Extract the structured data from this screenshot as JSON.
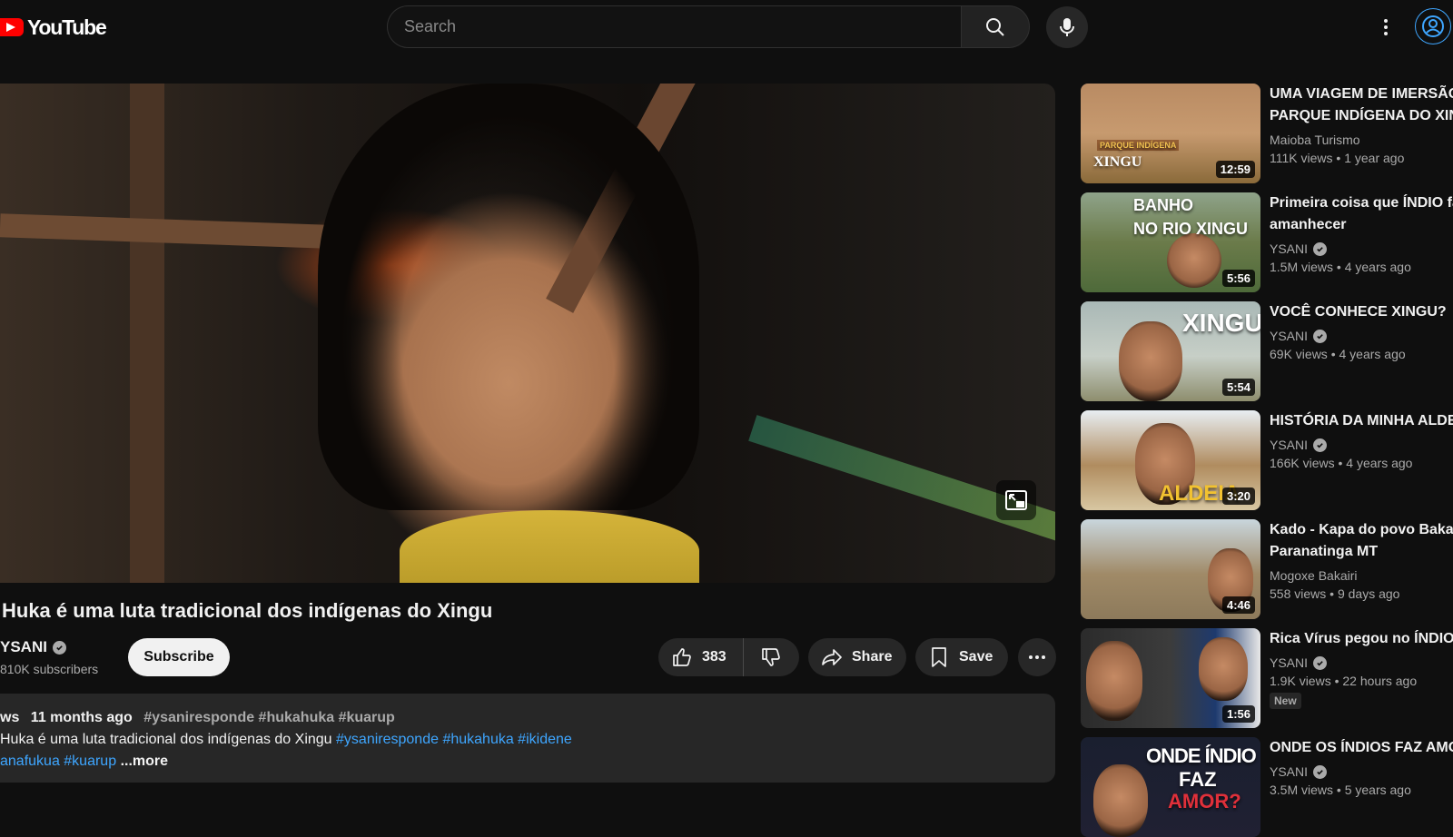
{
  "header": {
    "logo_text": "YouTube",
    "search_placeholder": "Search"
  },
  "player": {
    "title": "Huka é uma luta tradicional dos indígenas do Xingu"
  },
  "owner": {
    "channel": "YSANI",
    "subscribers": "810K subscribers",
    "subscribe_label": "Subscribe"
  },
  "actions": {
    "likes": "383",
    "share_label": "Share",
    "save_label": "Save"
  },
  "description": {
    "views_fragment": "ws",
    "date": "11 months ago",
    "tags": "#ysaniresponde #hukahuka #kuarup",
    "line1_text": "Huka é uma luta tradicional dos indígenas do Xingu",
    "line1_tags": "#ysaniresponde #hukahuka #ikidene",
    "line2_tags": "anafukua #kuarup",
    "more": "...more"
  },
  "recommendations": [
    {
      "title1": "UMA VIAGEM DE IMERSÃO",
      "title2": "PARQUE INDÍGENA DO XIN",
      "channel": "Maioba Turismo",
      "verified": false,
      "views": "111K views",
      "age": "1 year ago",
      "duration": "12:59",
      "overlay": "XINGU",
      "overlay_small": "PARQUE INDÍGENA",
      "badge": ""
    },
    {
      "title1": "Primeira coisa que ÍNDIO fa",
      "title2": "amanhecer",
      "channel": "YSANI",
      "verified": true,
      "views": "1.5M views",
      "age": "4 years ago",
      "duration": "5:56",
      "overlay": "BANHO",
      "overlay2": "NO RIO XINGU",
      "badge": ""
    },
    {
      "title1": "VOCÊ CONHECE XINGU?",
      "title2": "",
      "channel": "YSANI",
      "verified": true,
      "views": "69K views",
      "age": "4 years ago",
      "duration": "5:54",
      "overlay": "XINGU",
      "badge": ""
    },
    {
      "title1": "HISTÓRIA DA MINHA ALDE",
      "title2": "",
      "channel": "YSANI",
      "verified": true,
      "views": "166K views",
      "age": "4 years ago",
      "duration": "3:20",
      "overlay": "ALDEIA",
      "badge": ""
    },
    {
      "title1": "Kado - Kapa do povo Bakair",
      "title2": "Paranatinga MT",
      "channel": "Mogoxe Bakairi",
      "verified": false,
      "views": "558 views",
      "age": "9 days ago",
      "duration": "4:46",
      "overlay": "",
      "badge": ""
    },
    {
      "title1": "Rica Vírus pegou no ÍNDIO",
      "title2": "",
      "channel": "YSANI",
      "verified": true,
      "views": "1.9K views",
      "age": "22 hours ago",
      "duration": "1:56",
      "overlay": "",
      "badge": "New"
    },
    {
      "title1": "ONDE OS ÍNDIOS FAZ AMOR",
      "title2": "",
      "channel": "YSANI",
      "verified": true,
      "views": "3.5M views",
      "age": "5 years ago",
      "duration": "",
      "overlay": "ONDE ÍNDIO",
      "overlay2": "FAZ",
      "overlay3": "AMOR?",
      "badge": ""
    }
  ],
  "colors": {
    "background": "#0f0f0f",
    "surface": "#272727",
    "link": "#3ea6ff",
    "brand_red": "#ff0000"
  }
}
